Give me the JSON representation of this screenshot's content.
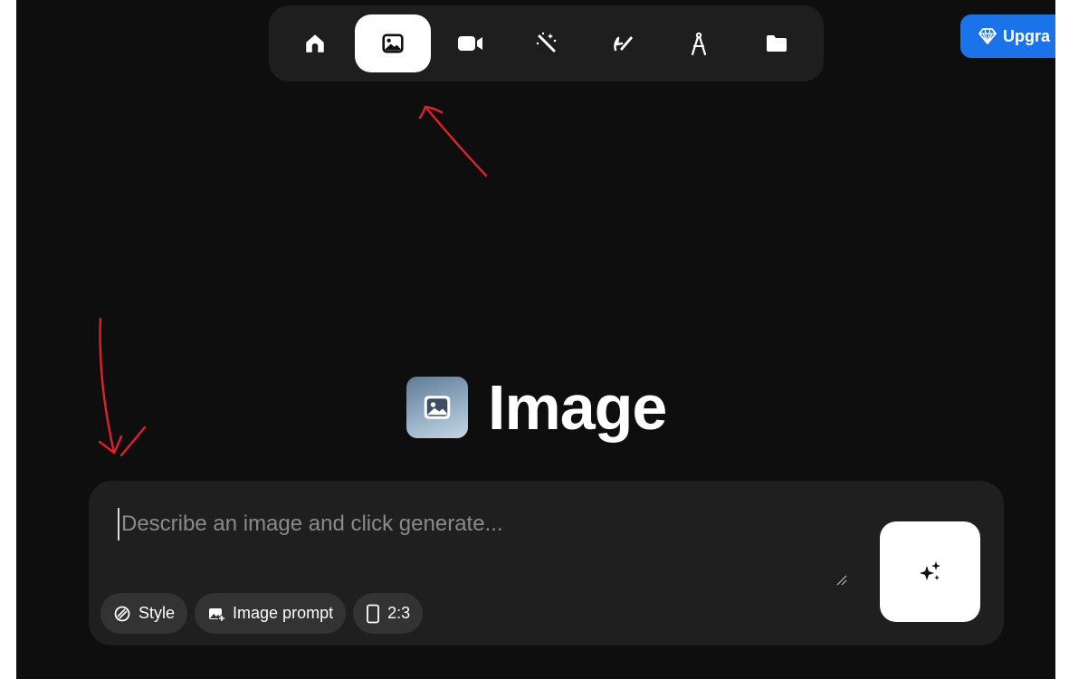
{
  "nav": {
    "items": [
      {
        "name": "home",
        "icon": "home-icon",
        "active": false
      },
      {
        "name": "image",
        "icon": "image-icon",
        "active": true
      },
      {
        "name": "video",
        "icon": "video-camera-icon",
        "active": false
      },
      {
        "name": "enhance",
        "icon": "magic-wand-icon",
        "active": false
      },
      {
        "name": "edit",
        "icon": "brush-pen-icon",
        "active": false
      },
      {
        "name": "draw",
        "icon": "compass-icon",
        "active": false
      },
      {
        "name": "assets",
        "icon": "folder-icon",
        "active": false
      }
    ]
  },
  "upgrade": {
    "label": "Upgra",
    "icon": "diamond-icon",
    "color": "#1a73e8"
  },
  "heading": {
    "title": "Image",
    "icon": "image-icon"
  },
  "prompt": {
    "placeholder": "Describe an image and click generate...",
    "value": ""
  },
  "chips": {
    "style": "Style",
    "image_prompt": "Image prompt",
    "aspect": "2:3"
  },
  "generate": {
    "icon": "sparkles-icon"
  },
  "annotations": {
    "color": "#e0202a",
    "arrows": [
      "arrow-to-image-tab",
      "arrow-to-prompt-box"
    ]
  }
}
